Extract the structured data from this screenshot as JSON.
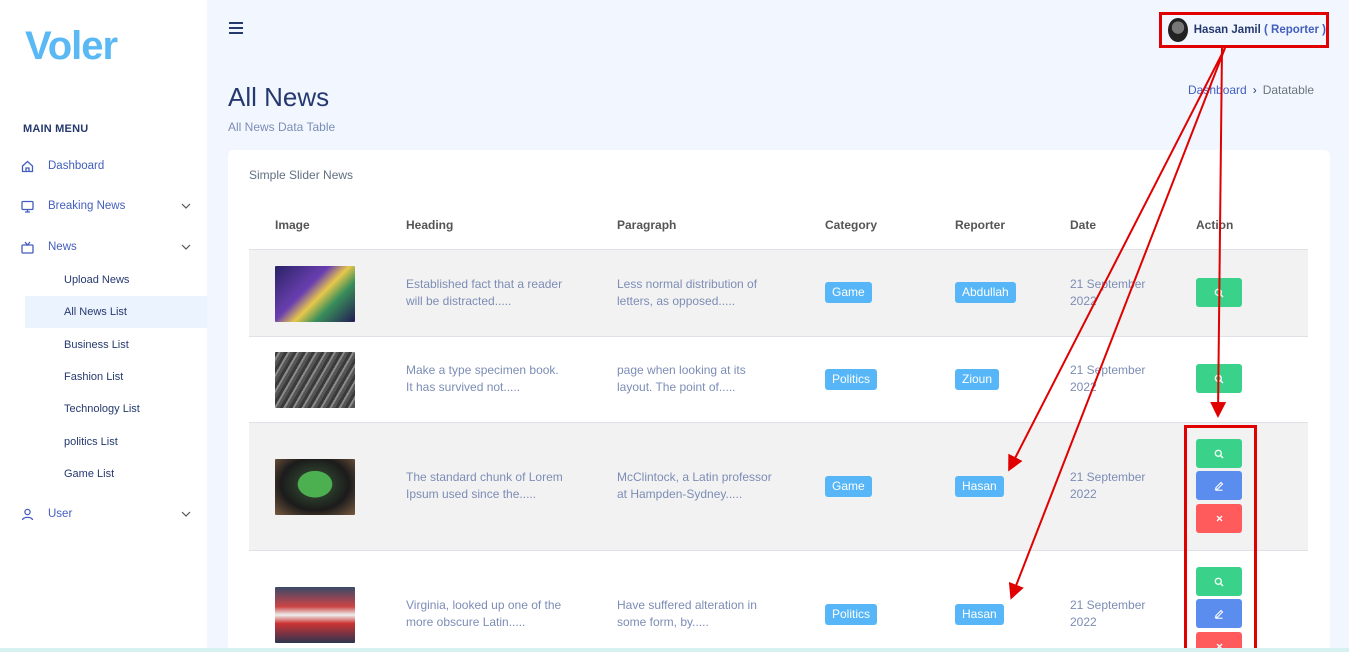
{
  "brand": {
    "logo_text": "Voler",
    "color": "#5ab8f5"
  },
  "sidebar": {
    "section_title": "MAIN MENU",
    "items": [
      {
        "label": "Dashboard",
        "icon": "home-icon"
      },
      {
        "label": "Breaking News",
        "icon": "monitor-icon"
      },
      {
        "label": "News",
        "icon": "tv-icon"
      },
      {
        "label": "User",
        "icon": "user-icon"
      }
    ],
    "news_subitems": [
      {
        "label": "Upload News"
      },
      {
        "label": "All News List",
        "active": true
      },
      {
        "label": "Business List"
      },
      {
        "label": "Fashion List"
      },
      {
        "label": "Technology List"
      },
      {
        "label": "politics List"
      },
      {
        "label": "Game List"
      }
    ]
  },
  "topbar": {
    "user_name": "Hasan Jamil",
    "user_role": "( Reporter )"
  },
  "page": {
    "title": "All News",
    "subtitle": "All News Data Table",
    "breadcrumb": {
      "link": "Dashboard",
      "separator": "›",
      "current": "Datatable"
    }
  },
  "card": {
    "title": "Simple Slider News",
    "columns": [
      "Image",
      "Heading",
      "Paragraph",
      "Category",
      "Reporter",
      "Date",
      "Action"
    ],
    "rows": [
      {
        "heading_1": "Established fact that a reader",
        "heading_2": "will be distracted.....",
        "para_1": "Less normal distribution of",
        "para_2": "letters, as opposed.....",
        "category": "Game",
        "reporter": "Abdullah",
        "date_1": "21 September",
        "date_2": "2022",
        "image": "phone-game-image"
      },
      {
        "heading_1": "Make a type specimen book.",
        "heading_2": "It has survived not.....",
        "para_1": "page when looking at its",
        "para_2": "layout. The point of.....",
        "category": "Politics",
        "reporter": "Zioun",
        "date_1": "21 September",
        "date_2": "2022",
        "image": "rain-window-image"
      },
      {
        "heading_1": "The standard chunk of Lorem",
        "heading_2": "Ipsum used since the.....",
        "para_1": "McClintock, a Latin professor",
        "para_2": "at Hampden-Sydney.....",
        "category": "Game",
        "reporter": "Hasan",
        "date_1": "21 September",
        "date_2": "2022",
        "image": "football-tv-image"
      },
      {
        "heading_1": "Virginia, looked up one of the",
        "heading_2": "more obscure Latin.....",
        "para_1": "Have suffered alteration in",
        "para_2": "some form, by.....",
        "category": "Politics",
        "reporter": "Hasan",
        "date_1": "21 September",
        "date_2": "2022",
        "image": "protest-crowd-image"
      }
    ]
  },
  "colors": {
    "badge": "#56b6f7",
    "view_button": "#3ad28a",
    "edit_button": "#5a8dee",
    "delete_button": "#ff5b5c",
    "annotation": "#e00000"
  }
}
